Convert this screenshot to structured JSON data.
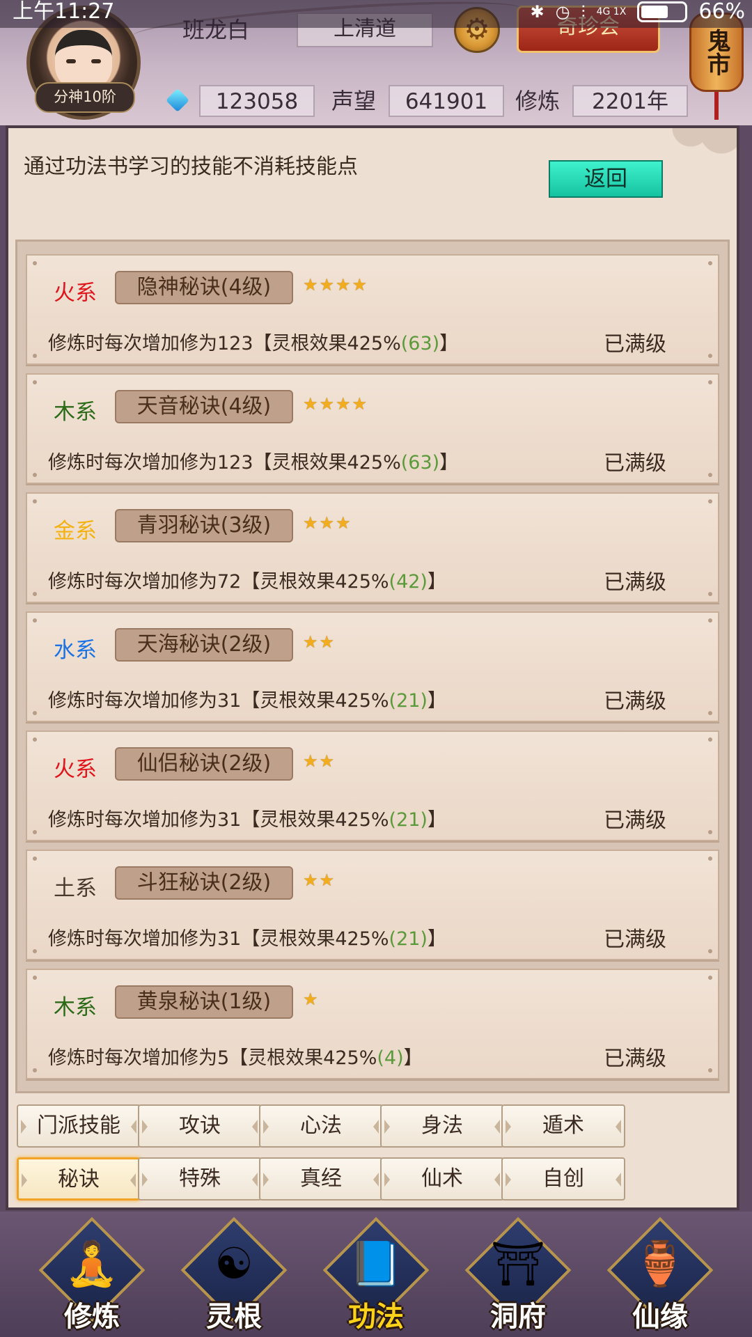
{
  "status_bar": {
    "time": "上午11:27",
    "battery": "66%",
    "battery_level": 0.66,
    "network": "4G 1X"
  },
  "player": {
    "rank": "分神10阶",
    "name": "班龙白",
    "sect": "上清道",
    "gems": "123058",
    "prestige_label": "声望",
    "prestige": "641901",
    "cultivation_label": "修炼",
    "cultivation": "2201年"
  },
  "header_buttons": {
    "qizhen": "奇珍会",
    "guishi": "鬼市",
    "settings_icon": "gear-icon"
  },
  "panel": {
    "hint": "通过功法书学习的技能不消耗技能点",
    "back_label": "返回"
  },
  "skills": [
    {
      "element": "火系",
      "element_color": "#e0141a",
      "name": "隐神秘诀(4级)",
      "stars": "★★★★",
      "desc_prefix": "修炼时每次增加修为123【灵根效果425%",
      "bonus": "(63)",
      "desc_suffix": "】",
      "status": "已满级"
    },
    {
      "element": "木系",
      "element_color": "#2b6a17",
      "name": "天音秘诀(4级)",
      "stars": "★★★★",
      "desc_prefix": "修炼时每次增加修为123【灵根效果425%",
      "bonus": "(63)",
      "desc_suffix": "】",
      "status": "已满级"
    },
    {
      "element": "金系",
      "element_color": "#f3b20f",
      "name": "青羽秘诀(3级)",
      "stars": "★★★",
      "desc_prefix": "修炼时每次增加修为72【灵根效果425%",
      "bonus": "(42)",
      "desc_suffix": "】",
      "status": "已满级"
    },
    {
      "element": "水系",
      "element_color": "#1a72e4",
      "name": "天海秘诀(2级)",
      "stars": "★★",
      "desc_prefix": "修炼时每次增加修为31【灵根效果425%",
      "bonus": "(21)",
      "desc_suffix": "】",
      "status": "已满级"
    },
    {
      "element": "火系",
      "element_color": "#e0141a",
      "name": "仙侣秘诀(2级)",
      "stars": "★★",
      "desc_prefix": "修炼时每次增加修为31【灵根效果425%",
      "bonus": "(21)",
      "desc_suffix": "】",
      "status": "已满级"
    },
    {
      "element": "土系",
      "element_color": "#4a3a2e",
      "name": "斗狂秘诀(2级)",
      "stars": "★★",
      "desc_prefix": "修炼时每次增加修为31【灵根效果425%",
      "bonus": "(21)",
      "desc_suffix": "】",
      "status": "已满级"
    },
    {
      "element": "木系",
      "element_color": "#2b6a17",
      "name": "黄泉秘诀(1级)",
      "stars": "★",
      "desc_prefix": "修炼时每次增加修为5【灵根效果425%",
      "bonus": "(4)",
      "desc_suffix": "】",
      "status": "已满级"
    }
  ],
  "tabs": {
    "row1": [
      "门派技能",
      "攻诀",
      "心法",
      "身法",
      "遁术"
    ],
    "row2": [
      "秘诀",
      "特殊",
      "真经",
      "仙术",
      "自创"
    ],
    "active": "秘诀"
  },
  "bottom_nav": [
    {
      "label": "修炼",
      "icon": "meditating-monk-icon",
      "active": false
    },
    {
      "label": "灵根",
      "icon": "yinyang-sword-icon",
      "active": false
    },
    {
      "label": "功法",
      "icon": "book-icon",
      "active": true
    },
    {
      "label": "洞府",
      "icon": "pagoda-icon",
      "active": false
    },
    {
      "label": "仙缘",
      "icon": "gourd-icon",
      "active": false
    }
  ]
}
